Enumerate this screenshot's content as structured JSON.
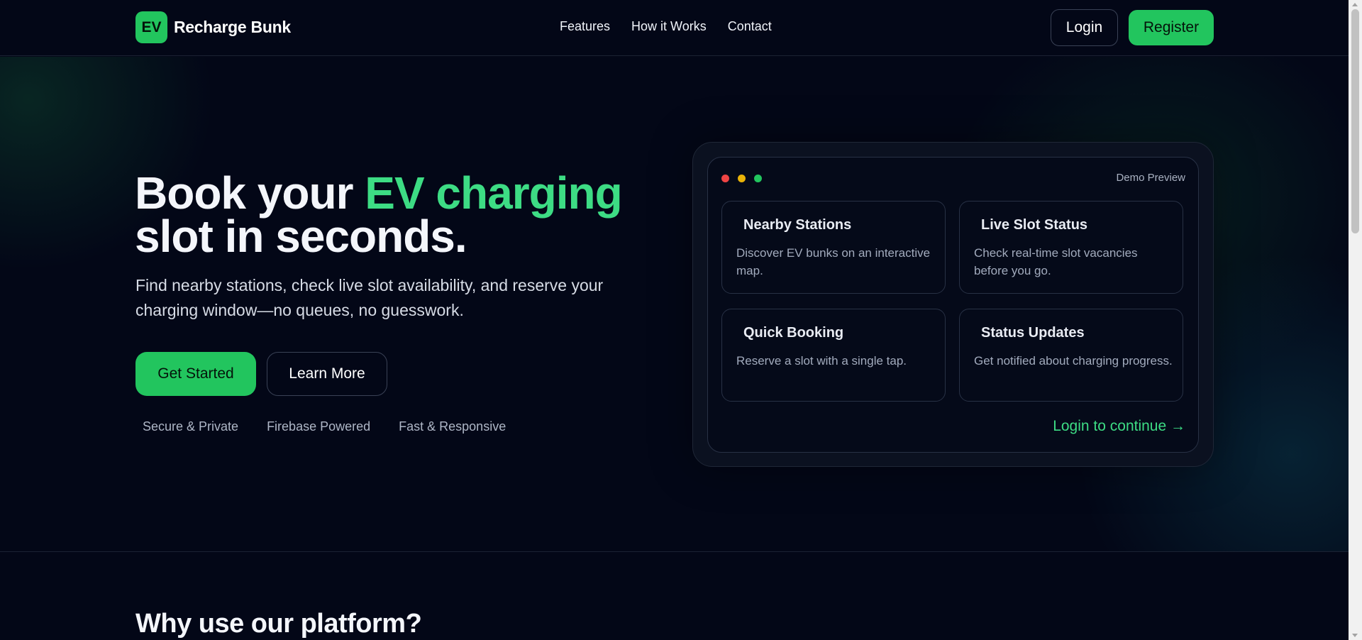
{
  "nav": {
    "logo_text": "EV",
    "brand_name": "Recharge Bunk",
    "links": [
      "Features",
      "How it Works",
      "Contact"
    ],
    "login_label": "Login",
    "register_label": "Register"
  },
  "hero": {
    "title_part1": "Book your ",
    "title_accent": "EV charging",
    "title_part2": "slot in seconds.",
    "subtitle": "Find nearby stations, check live slot availability, and reserve your charging window—no queues, no guesswork.",
    "get_started_label": "Get Started",
    "learn_more_label": "Learn More",
    "trust_items": [
      "Secure & Private",
      "Firebase Powered",
      "Fast & Responsive"
    ]
  },
  "demo": {
    "label": "Demo Preview",
    "cards": [
      {
        "title": "Nearby Stations",
        "description": "Discover EV bunks on an interactive map."
      },
      {
        "title": "Live Slot Status",
        "description": "Check real-time slot vacancies before you go."
      },
      {
        "title": "Quick Booking",
        "description": "Reserve a slot with a single tap."
      },
      {
        "title": "Status Updates",
        "description": "Get notified about charging progress."
      }
    ],
    "cta": "Login to continue →"
  },
  "section": {
    "heading": "Why use our platform?"
  },
  "colors": {
    "background": "#030717",
    "accent": "#22c55e",
    "accent_text": "#3ddc84"
  }
}
